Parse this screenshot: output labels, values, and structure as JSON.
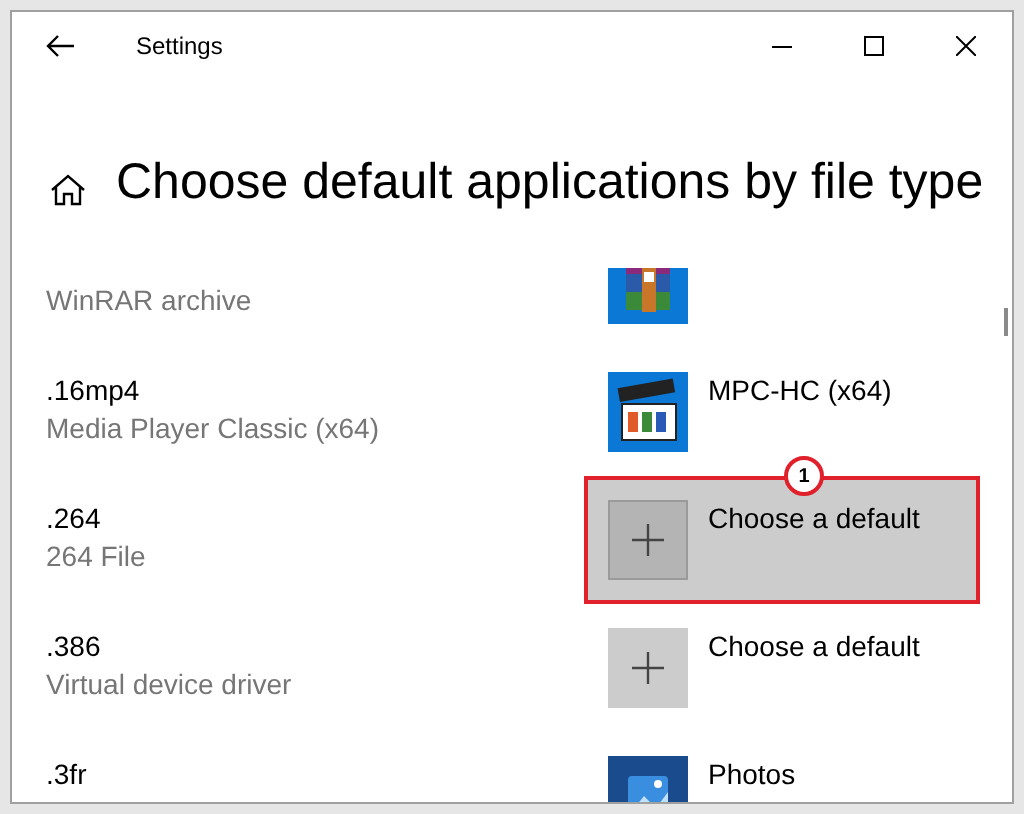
{
  "window": {
    "title": "Settings"
  },
  "heading": "Choose default applications by file type",
  "rows": [
    {
      "description": "WinRAR archive",
      "app": {
        "kind": "winrar"
      },
      "highlighted": false
    },
    {
      "extension": ".16mp4",
      "description": "Media Player Classic (x64)",
      "app": {
        "kind": "mpc",
        "name": "MPC-HC (x64)"
      },
      "highlighted": false
    },
    {
      "extension": ".264",
      "description": "264 File",
      "app": {
        "kind": "choose",
        "name": "Choose a default"
      },
      "highlighted": true,
      "badge": "1"
    },
    {
      "extension": ".386",
      "description": "Virtual device driver",
      "app": {
        "kind": "choose",
        "name": "Choose a default"
      },
      "highlighted": false
    },
    {
      "extension": ".3fr",
      "app": {
        "kind": "photos",
        "name": "Photos"
      },
      "highlighted": false
    }
  ]
}
